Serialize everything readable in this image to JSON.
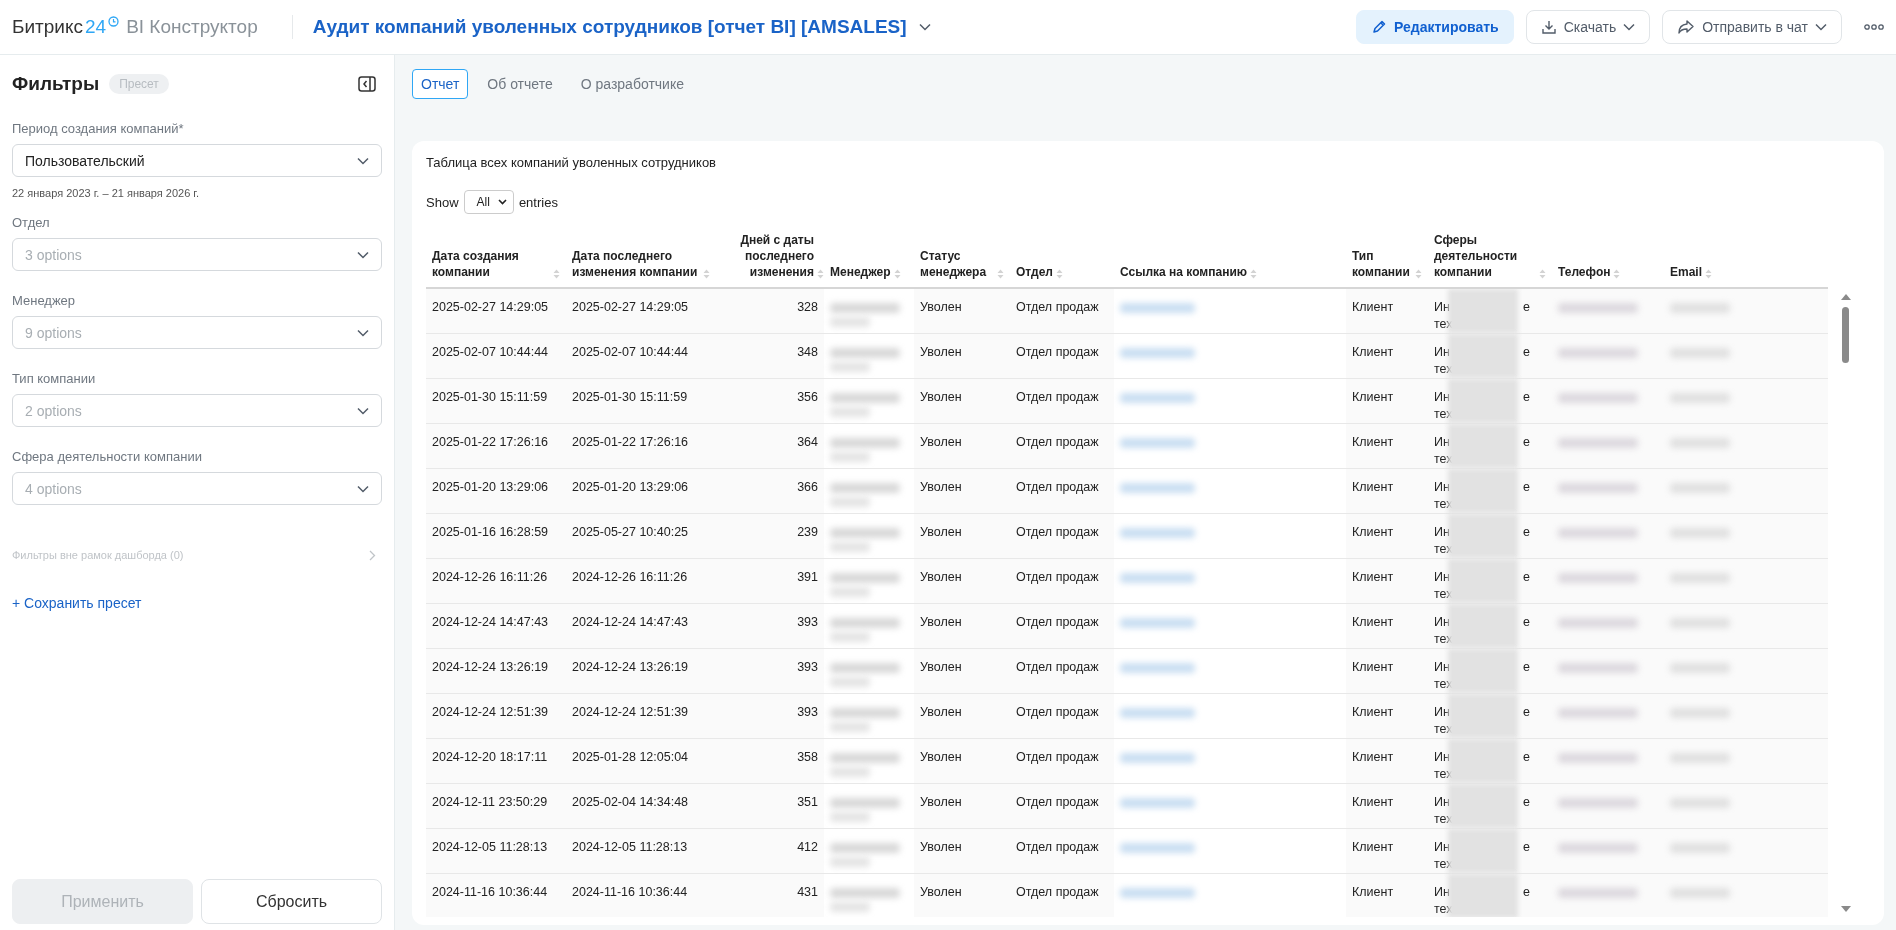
{
  "header": {
    "logo": {
      "name": "Битрикс",
      "number": "24",
      "product": "BI Конструктор"
    },
    "title": "Аудит компаний уволенных сотрудников [отчет BI] [AMSALES]",
    "actions": [
      {
        "label": "Редактировать",
        "kind": "edit"
      },
      {
        "label": "Скачать",
        "kind": "download"
      },
      {
        "label": "Отправить в чат",
        "kind": "share"
      }
    ]
  },
  "sidebar": {
    "title": "Фильтры",
    "badge": "Пресет",
    "filters": [
      {
        "label": "Период создания компаний*",
        "value": "Пользовательский",
        "note": "22 января 2023 г. – 21 января 2026 г."
      },
      {
        "label": "Отдел",
        "placeholder": "3 options"
      },
      {
        "label": "Менеджер",
        "placeholder": "9 options"
      },
      {
        "label": "Тип компании",
        "placeholder": "2 options"
      },
      {
        "label": "Сфера деятельности компании",
        "placeholder": "4 options"
      }
    ],
    "outside_filters": {
      "label": "Фильтры вне рамок дашборда (0)",
      "disabled": true
    },
    "save_preset": "+ Сохранить пресет",
    "buttons": [
      {
        "label": "Применить",
        "disabled": true
      },
      {
        "label": "Сбросить",
        "disabled": false
      }
    ]
  },
  "tabs": [
    {
      "label": "Отчет",
      "selected": true
    },
    {
      "label": "Об отчете",
      "selected": false
    },
    {
      "label": "О разработчике",
      "selected": false
    }
  ],
  "report": {
    "title": "Таблица всех компаний уволенных сотрудников",
    "show_label": "Show",
    "page_length": "All",
    "entries_label": "entries",
    "columns": [
      "Дата создания компании",
      "Дата последнего изменения компании",
      "Дней с даты последнего изменения",
      "Менеджер",
      "Статус менеджера",
      "Отдел",
      "Ссылка на компанию",
      "Тип компании",
      "Сферы деятельности компании",
      "Телефон",
      "Email"
    ],
    "rows": [
      {
        "created": "2025-02-27 14:29:05",
        "modified": "2025-02-27 14:29:05",
        "days": "328",
        "status": "Уволен",
        "dept": "Отдел продаж",
        "type": "Клиент",
        "sphere": [
          "Ин",
          "е",
          "тех"
        ]
      },
      {
        "created": "2025-02-07 10:44:44",
        "modified": "2025-02-07 10:44:44",
        "days": "348",
        "status": "Уволен",
        "dept": "Отдел продаж",
        "type": "Клиент",
        "sphere": [
          "Ин",
          "е",
          "тех"
        ]
      },
      {
        "created": "2025-01-30 15:11:59",
        "modified": "2025-01-30 15:11:59",
        "days": "356",
        "status": "Уволен",
        "dept": "Отдел продаж",
        "type": "Клиент",
        "sphere": [
          "Ин",
          "е",
          "тех"
        ]
      },
      {
        "created": "2025-01-22 17:26:16",
        "modified": "2025-01-22 17:26:16",
        "days": "364",
        "status": "Уволен",
        "dept": "Отдел продаж",
        "type": "Клиент",
        "sphere": [
          "Ин",
          "е",
          "тех"
        ]
      },
      {
        "created": "2025-01-20 13:29:06",
        "modified": "2025-01-20 13:29:06",
        "days": "366",
        "status": "Уволен",
        "dept": "Отдел продаж",
        "type": "Клиент",
        "sphere": [
          "Ин",
          "е",
          "тех"
        ]
      },
      {
        "created": "2025-01-16 16:28:59",
        "modified": "2025-05-27 10:40:25",
        "days": "239",
        "status": "Уволен",
        "dept": "Отдел продаж",
        "type": "Клиент",
        "sphere": [
          "Ин",
          "е",
          "тех"
        ]
      },
      {
        "created": "2024-12-26 16:11:26",
        "modified": "2024-12-26 16:11:26",
        "days": "391",
        "status": "Уволен",
        "dept": "Отдел продаж",
        "type": "Клиент",
        "sphere": [
          "Ин",
          "е",
          "тех"
        ]
      },
      {
        "created": "2024-12-24 14:47:43",
        "modified": "2024-12-24 14:47:43",
        "days": "393",
        "status": "Уволен",
        "dept": "Отдел продаж",
        "type": "Клиент",
        "sphere": [
          "Ин",
          "е",
          "тех"
        ]
      },
      {
        "created": "2024-12-24 13:26:19",
        "modified": "2024-12-24 13:26:19",
        "days": "393",
        "status": "Уволен",
        "dept": "Отдел продаж",
        "type": "Клиент",
        "sphere": [
          "Ин",
          "е",
          "тех"
        ]
      },
      {
        "created": "2024-12-24 12:51:39",
        "modified": "2024-12-24 12:51:39",
        "days": "393",
        "status": "Уволен",
        "dept": "Отдел продаж",
        "type": "Клиент",
        "sphere": [
          "Ин",
          "е",
          "тех"
        ]
      },
      {
        "created": "2024-12-20 18:17:11",
        "modified": "2025-01-28 12:05:04",
        "days": "358",
        "status": "Уволен",
        "dept": "Отдел продаж",
        "type": "Клиент",
        "sphere": [
          "Ин",
          "е",
          "тех"
        ]
      },
      {
        "created": "2024-12-11 23:50:29",
        "modified": "2025-02-04 14:34:48",
        "days": "351",
        "status": "Уволен",
        "dept": "Отдел продаж",
        "type": "Клиент",
        "sphere": [
          "Ин",
          "е",
          "тех"
        ]
      },
      {
        "created": "2024-12-05 11:28:13",
        "modified": "2024-12-05 11:28:13",
        "days": "412",
        "status": "Уволен",
        "dept": "Отдел продаж",
        "type": "Клиент",
        "sphere": [
          "Ин",
          "е",
          "тех"
        ]
      },
      {
        "created": "2024-11-16 10:36:44",
        "modified": "2024-11-16 10:36:44",
        "days": "431",
        "status": "Уволен",
        "dept": "Отдел продаж",
        "type": "Клиент",
        "sphere": [
          "Ин",
          "е",
          "тех"
        ]
      }
    ]
  }
}
